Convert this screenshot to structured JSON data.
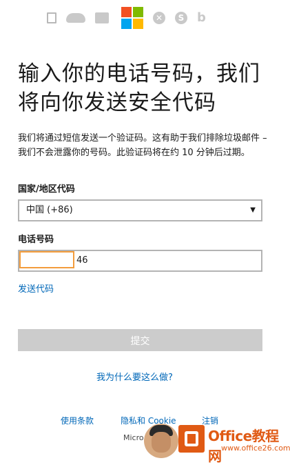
{
  "header": {
    "icons": [
      "office-icon",
      "onedrive-icon",
      "outlook-icon",
      "microsoft-logo",
      "xbox-icon",
      "skype-icon",
      "bing-icon"
    ],
    "ms_colors": [
      "#f25022",
      "#7fba00",
      "#00a4ef",
      "#ffb900"
    ]
  },
  "title": "输入你的电话号码，我们将向你发送安全代码",
  "description": "我们将通过短信发送一个验证码。这有助于我们排除垃圾邮件 – 我们不会泄露你的号码。此验证码将在约 10 分钟后过期。",
  "country": {
    "label": "国家/地区代码",
    "selected": "中国 (+86)",
    "arrow": "▼"
  },
  "phone": {
    "label": "电话号码",
    "value": "46"
  },
  "send_code_link": "发送代码",
  "submit_label": "提交",
  "why_link": "我为什么要这么做?",
  "footer": {
    "terms": "使用条款",
    "privacy": "隐私和 Cookie",
    "signout": "注销",
    "ms": "Micro"
  },
  "watermark": {
    "title": "Office教程网",
    "url": "www.office26.com"
  },
  "accent_color": "#0067b8"
}
